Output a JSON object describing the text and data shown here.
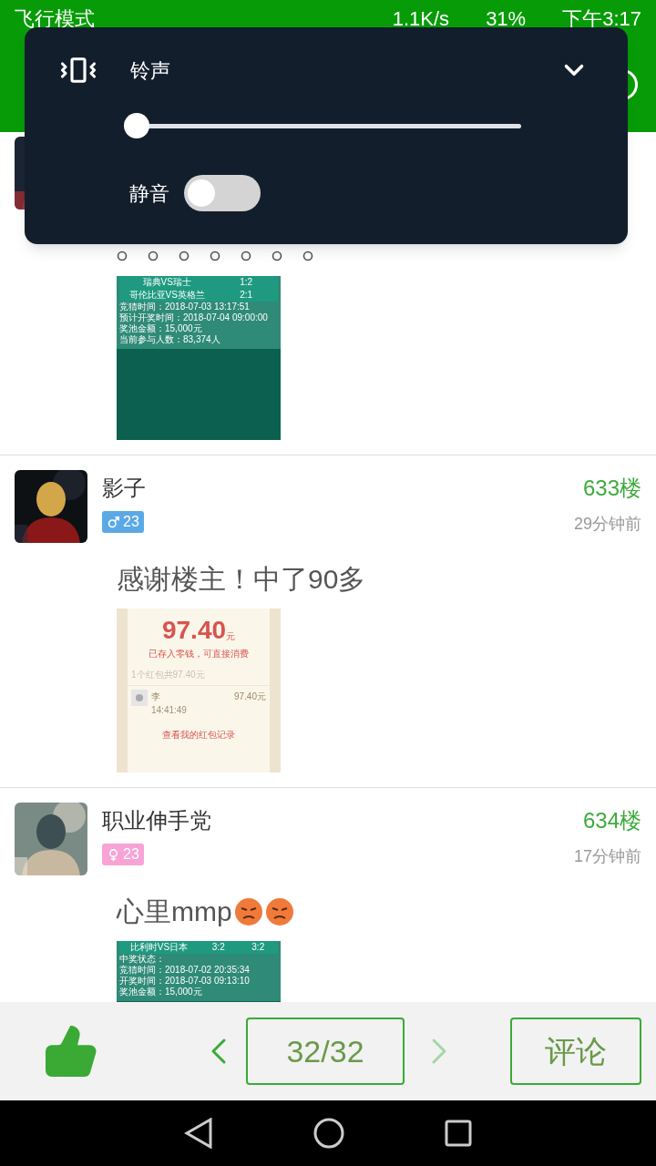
{
  "status_bar": {
    "mode": "飞行模式",
    "speed": "1.1K/s",
    "battery": "31%",
    "time": "下午3:17"
  },
  "volume_panel": {
    "label": "铃声",
    "level": 0.0,
    "expanded": false,
    "mute_label": "静音",
    "mute_on": false
  },
  "posts": [
    {
      "thumbnail": {
        "kind": "match-card",
        "rows": [
          [
            "瑞典VS瑞士",
            "1:2"
          ],
          [
            "哥伦比亚VS英格兰",
            "2:1"
          ]
        ],
        "lines": [
          "竞猜时间：2018-07-03 13:17:51",
          "预计开奖时间：2018-07-04 09:00:00",
          "奖池金额：15,000元",
          "当前参与人数：83,374人"
        ]
      }
    },
    {
      "name": "影子",
      "badge": {
        "kind": "male",
        "age": "23"
      },
      "floor": "633楼",
      "time": "29分钟前",
      "content": "感谢楼主！中了90多",
      "thumbnail": {
        "kind": "red-packet",
        "amount": "97.40",
        "unit": "元",
        "note": "已存入零钱，可直接消费",
        "summary": "1个红包共97.40元",
        "sender": "李",
        "sent_time": "14:41:49",
        "sender_amount": "97.40元",
        "link": "查看我的红包记录"
      }
    },
    {
      "name": "职业伸手党",
      "badge": {
        "kind": "female",
        "age": "23"
      },
      "floor": "634楼",
      "time": "17分钟前",
      "content": "心里mmp",
      "emojis": [
        {
          "kind": "angry"
        },
        {
          "kind": "angry"
        }
      ],
      "thumbnail": {
        "kind": "match-card",
        "rows": [
          [
            "比利时VS日本",
            "3:2",
            "3:2"
          ]
        ],
        "lines": [
          "中奖状态：",
          "竞猜时间：2018-07-02 20:35:34",
          "开奖时间：2018-07-03 09:13:10",
          "奖池金额：15,000元"
        ]
      }
    }
  ],
  "bottom_bar": {
    "page": "32/32",
    "prev_disabled": false,
    "next_disabled": true,
    "comment": "评论"
  }
}
